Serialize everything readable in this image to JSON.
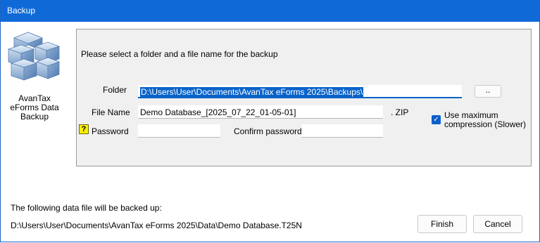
{
  "window": {
    "title": "Backup",
    "app_label": "AvanTax eForms Data Backup"
  },
  "icons": {
    "app_icon": "stacked-blue-cubes-icon",
    "help_icon_glyph": "?",
    "check_glyph": "✓"
  },
  "form": {
    "prompt": "Please select a folder and a file name for the backup",
    "folder_label": "Folder",
    "folder_value": "D:\\Users\\User\\Documents\\AvanTax eForms 2025\\Backups\\",
    "browse_label": "..",
    "file_name_label": "File Name",
    "file_name_value": "Demo Database_[2025_07_22_01-05-01]",
    "extension": ". ZIP",
    "password_label": "Password",
    "password_value": "",
    "confirm_label": "Confirm password",
    "confirm_value": "",
    "compression_line1": "Use maximum",
    "compression_line2": "compression (Slower)",
    "compression_checked": true
  },
  "footer": {
    "info_label": "The following data file will be backed up:",
    "file_path": "D:\\Users\\User\\Documents\\AvanTax eForms 2025\\Data\\Demo Database.T25N",
    "finish_label": "Finish",
    "cancel_label": "Cancel"
  },
  "colors": {
    "titlebar": "#0f6ad8",
    "accent": "#0a63c9",
    "help_yellow": "#ffef00",
    "panel_bg": "#f0f0f0"
  }
}
